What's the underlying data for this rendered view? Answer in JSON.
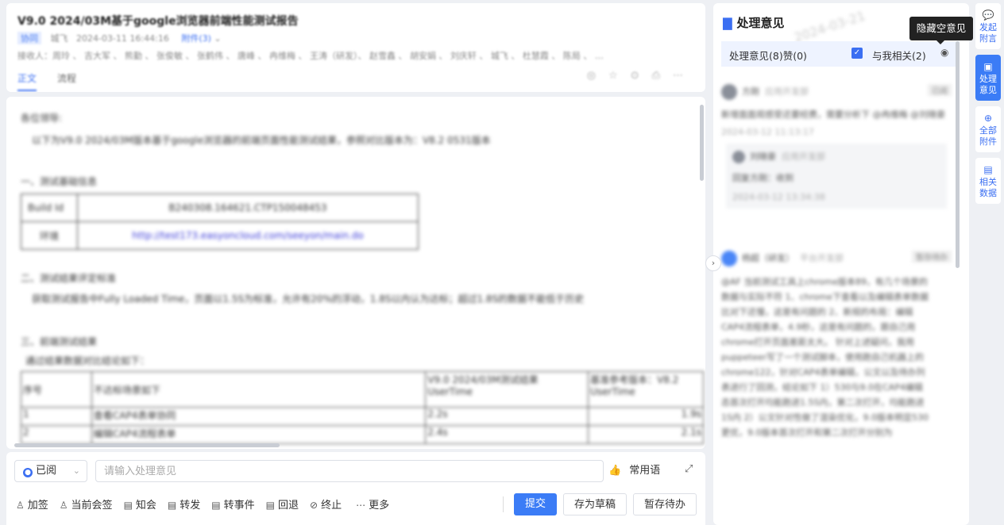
{
  "header": {
    "title": "V9.0 2024/03M基于google浏览器前端性能测试报告",
    "meta_tag": "协同",
    "author": "城飞",
    "datetime": "2024-03-11 16:44:16",
    "attachment_link": "附件(3)",
    "recipients": "接收人：周玲 、 吉大军 、 熊勤 、 张俊敏 、 张鹤伟 、 唐峰 、 冉维梅 、 王涛（研发）、 赵雪鑫 、 胡安娟 、 刘庆轩 、 城飞 、 杜慧霞 、 陈局 、 …",
    "tabs": [
      "正文",
      "流程"
    ],
    "tool_icons": [
      "◎",
      "☆",
      "⊙",
      "⎙",
      "⋯"
    ]
  },
  "document": {
    "greeting": "各位领导:",
    "intro": "以下为V9.0 2024/03M版本基于google浏览器的前端页面性能测试结果，参照对比版本为：V8.2 0531版本",
    "section1": "一、测试基础信息",
    "info_rows": [
      {
        "key": "Build Id",
        "value": "B240308.164621.CTP150048453"
      },
      {
        "key": "环境",
        "value": "http://test173.easyoncloud.com/seeyon/main.do"
      }
    ],
    "section2": "二、测试结果评定标准",
    "criteria": "获取测试报告中Fully Loaded Time，页面以1.5S为标准，允许有20%的浮动，1.8S以内认为达标；超过1.8S的数据不能低于历史",
    "section3": "三、前端测试结果",
    "result_intro": "通过结果数据对比结论如下：",
    "table_headers": [
      "序号",
      "不达标场景如下",
      "V9.0 2024/03M测试结果 UserTime",
      "基准参考版本：V8.2 UserTime"
    ],
    "table_rows": [
      [
        "1",
        "查看CAP4表单协同",
        "2.2s",
        "1.9s"
      ],
      [
        "2",
        "编辑CAP4流程表单",
        "2.4s",
        "2.1s"
      ]
    ]
  },
  "bottom_bar": {
    "read_status": "已阅",
    "input_placeholder": "请输入处理意见",
    "common_phrase": "常用语",
    "actions": [
      "加签",
      "当前会签",
      "知会",
      "转发",
      "转事件",
      "回退",
      "终止",
      "更多"
    ],
    "action_icons": [
      "♙",
      "♙",
      "▤",
      "▤",
      "▤",
      "▤",
      "⊘",
      "⋯"
    ],
    "submit": "提交",
    "save_draft": "存为草稿",
    "hold": "暂存待办"
  },
  "opinion_panel": {
    "title": "处理意见",
    "count_label": "处理意见(8)赞(0)",
    "related_label": "与我相关(2)",
    "related_checked": true,
    "tooltip": "隐藏空意见",
    "watermark": "2024-03-21",
    "opinions": [
      {
        "name": "方刚",
        "dept": "应用开发部",
        "status": "已阅",
        "text": "新增面面观感受还要经费，需要分析下 @冉维梅 @刘晓豪",
        "time": "2024-03-12 11:13:17",
        "reply_name": "刘晓豪",
        "reply_dept": "应用开发部",
        "reply_text": "回复方刚：收到",
        "reply_time": "2024-03-12 13:34:38"
      },
      {
        "name": "杨超（研发）",
        "dept": "平台开发部",
        "status": "暂存待办",
        "text": "@AF 当前测试工具上chrome版本89，有几个场景的数据与实际不符 1、chrome下查看以及编辑表单数据比对下还慢，这是有问题的 2、新规的布局：编辑CAP4流程表单，4.9秒，这是有问题的，跟自己用chrome打开页面差距太大。 针对上述疑问，我用puppeteer写了一个测试脚本，使用跑自己机器上的chrome122，针对CAP4表单编辑，公文以及待办列表进行了回测，结论如下 1）530与9.0在CAP4编辑态首次打开均能跑进1.5S内，第二次打开，均能跑进1S内 2）公文针对性做了渲染优化，9.0版本明显530更优，9.0版本首次打开和第二次打开分别为"
      }
    ]
  },
  "right_sidebar": [
    {
      "label": "发起附言",
      "icon": "💬",
      "active": false
    },
    {
      "label": "处理意见",
      "icon": "▣",
      "active": true
    },
    {
      "label": "全部附件",
      "icon": "⊕",
      "active": false
    },
    {
      "label": "相关数据",
      "icon": "▤",
      "active": false
    }
  ]
}
